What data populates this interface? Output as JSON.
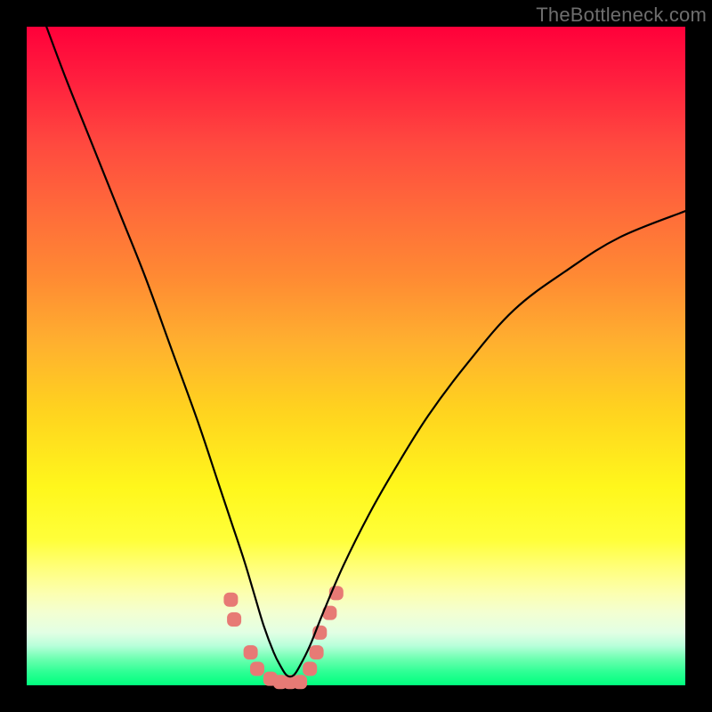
{
  "watermark": "TheBottleneck.com",
  "chart_data": {
    "type": "line",
    "title": "",
    "xlabel": "",
    "ylabel": "",
    "xlim": [
      0,
      100
    ],
    "ylim": [
      0,
      100
    ],
    "grid": false,
    "legend": false,
    "background_gradient_stops": [
      {
        "pos": 0,
        "color": "#ff003a"
      },
      {
        "pos": 28,
        "color": "#ff6b3a"
      },
      {
        "pos": 58,
        "color": "#ffd21f"
      },
      {
        "pos": 82,
        "color": "#ffff78"
      },
      {
        "pos": 96,
        "color": "#6cffb0"
      },
      {
        "pos": 100,
        "color": "#00ff7e"
      }
    ],
    "series": [
      {
        "name": "bottleneck-curve",
        "color": "#000000",
        "x": [
          3,
          6,
          10,
          14,
          18,
          22,
          26,
          29,
          31,
          33,
          34.5,
          36,
          37.5,
          38.5,
          39.5,
          40.5,
          41.5,
          43,
          45,
          48,
          52,
          56,
          61,
          67,
          74,
          82,
          90,
          100
        ],
        "y": [
          100,
          92,
          82,
          72,
          62,
          51,
          40,
          31,
          25,
          19,
          14,
          9,
          5,
          3,
          1.5,
          1.5,
          3,
          6,
          11,
          18,
          26,
          33,
          41,
          49,
          57,
          63,
          68,
          72
        ]
      },
      {
        "name": "highlight-markers",
        "color": "#e77a75",
        "type": "scatter",
        "x": [
          31,
          31.5,
          34,
          35,
          37,
          38.5,
          40,
          41.5,
          43,
          44,
          44.5,
          46,
          47
        ],
        "y": [
          13,
          10,
          5,
          2.5,
          1,
          0.5,
          0.5,
          0.5,
          2.5,
          5,
          8,
          11,
          14
        ]
      }
    ],
    "annotations": []
  }
}
